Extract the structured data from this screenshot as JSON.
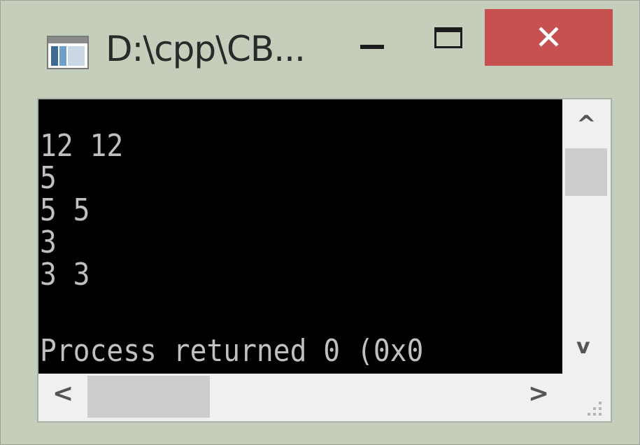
{
  "window": {
    "title": "D:\\cpp\\CB...",
    "minimize_glyph": "–",
    "close_glyph": "✕"
  },
  "console": {
    "lines": [
      "12 12",
      "5",
      "5 5",
      "3",
      "3 3",
      "",
      "Process returned 0 (0x0"
    ]
  },
  "scrollbars": {
    "up_arrow": "^",
    "down_arrow": "v",
    "left_arrow": "<",
    "right_arrow": ">"
  },
  "icons": {
    "app": "console-window-icon",
    "minimize": "minimize-icon",
    "maximize": "maximize-icon",
    "close": "close-icon",
    "resize_grip": "resize-grip-icon"
  },
  "colors": {
    "title_bar": "#c4cebb",
    "close_button": "#c75050",
    "console_bg": "#000000",
    "console_text": "#c0c0c0"
  }
}
